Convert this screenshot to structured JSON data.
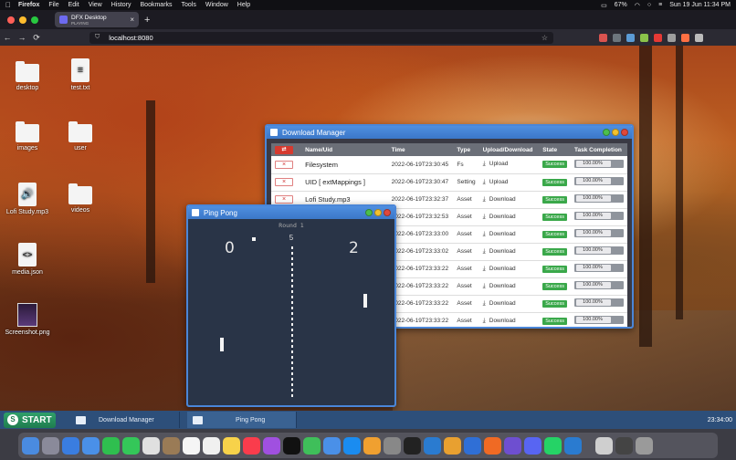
{
  "menubar": {
    "apple": "",
    "items": [
      "Firefox",
      "File",
      "Edit",
      "View",
      "History",
      "Bookmarks",
      "Tools",
      "Window",
      "Help"
    ],
    "battery": "67%",
    "datetime": "Sun 19 Jun  11:34 PM"
  },
  "browser": {
    "tab_title": "DFX Desktop",
    "tab_subtitle": "PLAYING",
    "tab_close": "×",
    "new_tab": "+",
    "url": "localhost:8080",
    "back": "←",
    "forward": "→",
    "reload": "⟳",
    "bookmark": "☆",
    "lock": "⛉"
  },
  "desktop": {
    "icons": [
      {
        "label": "desktop",
        "kind": "folder-icon"
      },
      {
        "label": "test.txt",
        "kind": "text-file-icon"
      },
      {
        "label": "images",
        "kind": "folder-icon"
      },
      {
        "label": "user",
        "kind": "folder-icon"
      },
      {
        "label": "Lofi Study.mp3",
        "kind": "audio-file-icon"
      },
      {
        "label": "videos",
        "kind": "folder-icon"
      },
      {
        "label": "media.json",
        "kind": "code-file-icon"
      },
      {
        "label": "Screenshot.png",
        "kind": "image-file-icon"
      }
    ],
    "glyphs": {
      "text": "≡",
      "audio": "🔊",
      "code": "<>"
    }
  },
  "download_manager": {
    "title": "Download Manager",
    "delete_all_glyph": "⇄",
    "delete_glyph": "×",
    "download_glyph": "⤓",
    "columns": [
      "",
      "Name/Uid",
      "Time",
      "Type",
      "Upload/Download",
      "State",
      "Task Completion"
    ],
    "rows": [
      {
        "name": "Filesystem",
        "time": "2022-06-19T23:30:45",
        "type": "Fs",
        "direction": "Upload",
        "state": "Success",
        "progress": "100.00%",
        "progress_value": 1.0
      },
      {
        "name": "UID [ extMappings ]",
        "time": "2022-06-19T23:30:47",
        "type": "Setting",
        "direction": "Upload",
        "state": "Success",
        "progress": "100.00%",
        "progress_value": 1.0
      },
      {
        "name": "Lofi Study.mp3",
        "time": "2022-06-19T23:32:37",
        "type": "Asset",
        "direction": "Download",
        "state": "Success",
        "progress": "100.00%",
        "progress_value": 1.0
      },
      {
        "name": "",
        "time": "2022-06-19T23:32:53",
        "type": "Asset",
        "direction": "Download",
        "state": "Success",
        "progress": "100.00%",
        "progress_value": 1.0
      },
      {
        "name": "",
        "time": "2022-06-19T23:33:00",
        "type": "Asset",
        "direction": "Download",
        "state": "Success",
        "progress": "100.00%",
        "progress_value": 1.0
      },
      {
        "name": "",
        "time": "2022-06-19T23:33:02",
        "type": "Asset",
        "direction": "Download",
        "state": "Success",
        "progress": "100.00%",
        "progress_value": 1.0
      },
      {
        "name": "",
        "time": "2022-06-19T23:33:22",
        "type": "Asset",
        "direction": "Download",
        "state": "Success",
        "progress": "100.00%",
        "progress_value": 1.0
      },
      {
        "name": "",
        "time": "2022-06-19T23:33:22",
        "type": "Asset",
        "direction": "Download",
        "state": "Success",
        "progress": "100.00%",
        "progress_value": 1.0
      },
      {
        "name": "",
        "time": "2022-06-19T23:33:22",
        "type": "Asset",
        "direction": "Download",
        "state": "Success",
        "progress": "100.00%",
        "progress_value": 1.0
      },
      {
        "name": "",
        "time": "2022-06-19T23:33:22",
        "type": "Asset",
        "direction": "Download",
        "state": "Success",
        "progress": "100.00%",
        "progress_value": 1.0
      }
    ]
  },
  "ping_pong": {
    "title": "Ping Pong",
    "round_label": "Round 1",
    "round_number": "5",
    "score_left": "0",
    "score_right": "2"
  },
  "taskbar": {
    "start_label": "START",
    "start_glyph": "S",
    "items": [
      "Download Manager",
      "Ping Pong"
    ],
    "clock": "23:34:00"
  },
  "colors": {
    "titlebar": "#4a86d8",
    "success": "#3aa84a",
    "danger": "#d63a2f",
    "taskbar": "#2d4f7a",
    "start": "#2fa06a",
    "court": "#293447"
  }
}
